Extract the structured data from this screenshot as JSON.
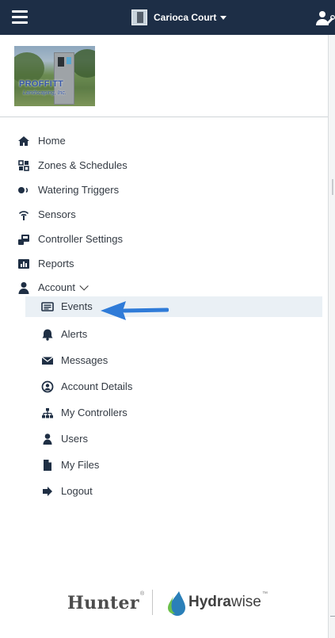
{
  "header": {
    "controller_name": "Carioca Court"
  },
  "company_logo": {
    "name": "PROFFITT",
    "subtitle": "Landscaping, Inc."
  },
  "nav": {
    "home": "Home",
    "zones": "Zones & Schedules",
    "triggers": "Watering Triggers",
    "sensors": "Sensors",
    "controller_settings": "Controller Settings",
    "reports": "Reports",
    "account": "Account"
  },
  "account_menu": {
    "events": "Events",
    "alerts": "Alerts",
    "messages": "Messages",
    "account_details": "Account Details",
    "my_controllers": "My Controllers",
    "users": "Users",
    "my_files": "My Files",
    "logout": "Logout"
  },
  "brand": {
    "hunter": "Hunter",
    "hunter_mark": "®",
    "hydra_a": "Hydra",
    "hydra_b": "wise",
    "tm": "™"
  },
  "colors": {
    "topbar": "#1d2e46",
    "active_bg": "#eaf0f5",
    "arrow": "#2f7bd8",
    "icon": "#1f2f44"
  }
}
